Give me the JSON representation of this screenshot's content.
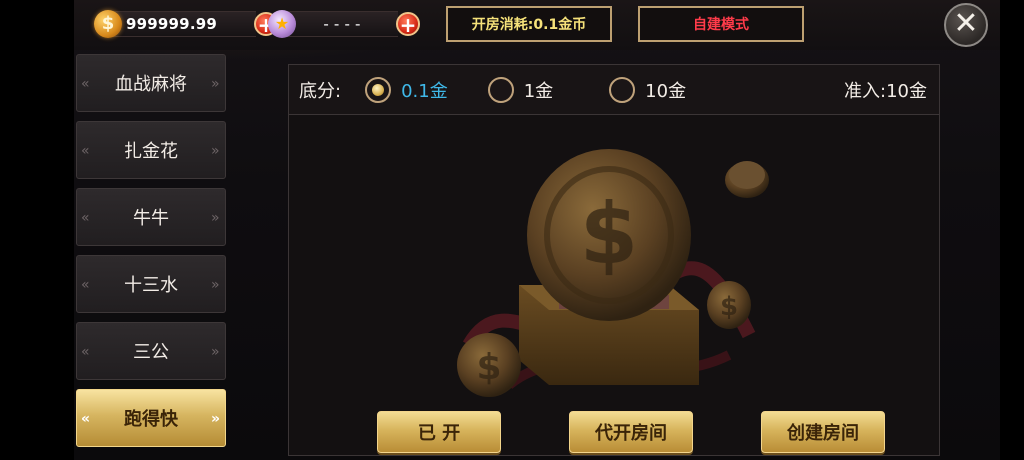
{
  "topbar": {
    "gold_amount": "999999.99",
    "diamond_amount": "- - - -",
    "room_cost": "开房消耗:0.1金币",
    "custom_mode": "自建模式",
    "close_glyph": "✕"
  },
  "sidebar": {
    "items": [
      {
        "label": "血战麻将",
        "active": false
      },
      {
        "label": "扎金花",
        "active": false
      },
      {
        "label": "牛牛",
        "active": false
      },
      {
        "label": "十三水",
        "active": false
      },
      {
        "label": "三公",
        "active": false
      },
      {
        "label": "跑得快",
        "active": true
      }
    ],
    "arrow_left": "«",
    "arrow_right": "»"
  },
  "panel": {
    "base_label": "底分:",
    "options": [
      {
        "label": "0.1金",
        "selected": true
      },
      {
        "label": "1金",
        "selected": false
      },
      {
        "label": "10金",
        "selected": false
      }
    ],
    "entry_requirement": "准入:10金"
  },
  "actions": {
    "opened": "已 开",
    "proxy_room": "代开房间",
    "create_room": "创建房间"
  },
  "colors": {
    "accent_gold": "#d7b45c",
    "selected_text": "#3fb8e8",
    "cost_text": "#f6e27a",
    "mode_text": "#ff3b4a"
  },
  "icons": {
    "gold": "gold-coin-icon",
    "diamond": "diamond-icon",
    "plus": "plus-icon",
    "close": "close-icon"
  }
}
